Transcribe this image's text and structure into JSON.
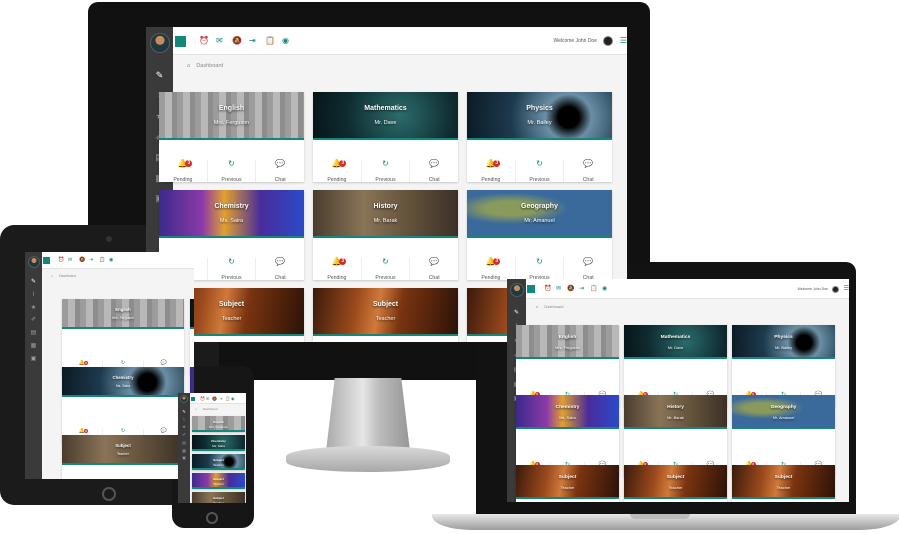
{
  "colors": {
    "accent": "#12877a",
    "alert": "#d42b2b",
    "sidebar": "#3a3a3a"
  },
  "header": {
    "welcome": "Welcome John Doe",
    "toolbar_icons": [
      "alarm-icon",
      "mail-icon",
      "notification-off-icon",
      "exit-icon",
      "clipboard-icon",
      "badge-icon"
    ]
  },
  "breadcrumb": {
    "label": "Dashboard"
  },
  "sidebar": {
    "icons": [
      "pencil-icon",
      "chart-icon",
      "star-icon",
      "edit-icon",
      "notes-icon",
      "calendar-icon",
      "bus-icon"
    ]
  },
  "actions": {
    "pending": "Pending",
    "previous": "Previous",
    "chat": "Chat",
    "badge_count": "3"
  },
  "cards": [
    {
      "subject": "English",
      "teacher": "Mrs. Ferguson"
    },
    {
      "subject": "Mathematics",
      "teacher": "Mr. Dave"
    },
    {
      "subject": "Physics",
      "teacher": "Mr. Bailey"
    },
    {
      "subject": "Chemistry",
      "teacher": "Ms. Saira"
    },
    {
      "subject": "History",
      "teacher": "Mr. Barak"
    },
    {
      "subject": "Geography",
      "teacher": "Mr. Amanuel"
    },
    {
      "subject": "Subject",
      "teacher": "Teacher"
    }
  ]
}
